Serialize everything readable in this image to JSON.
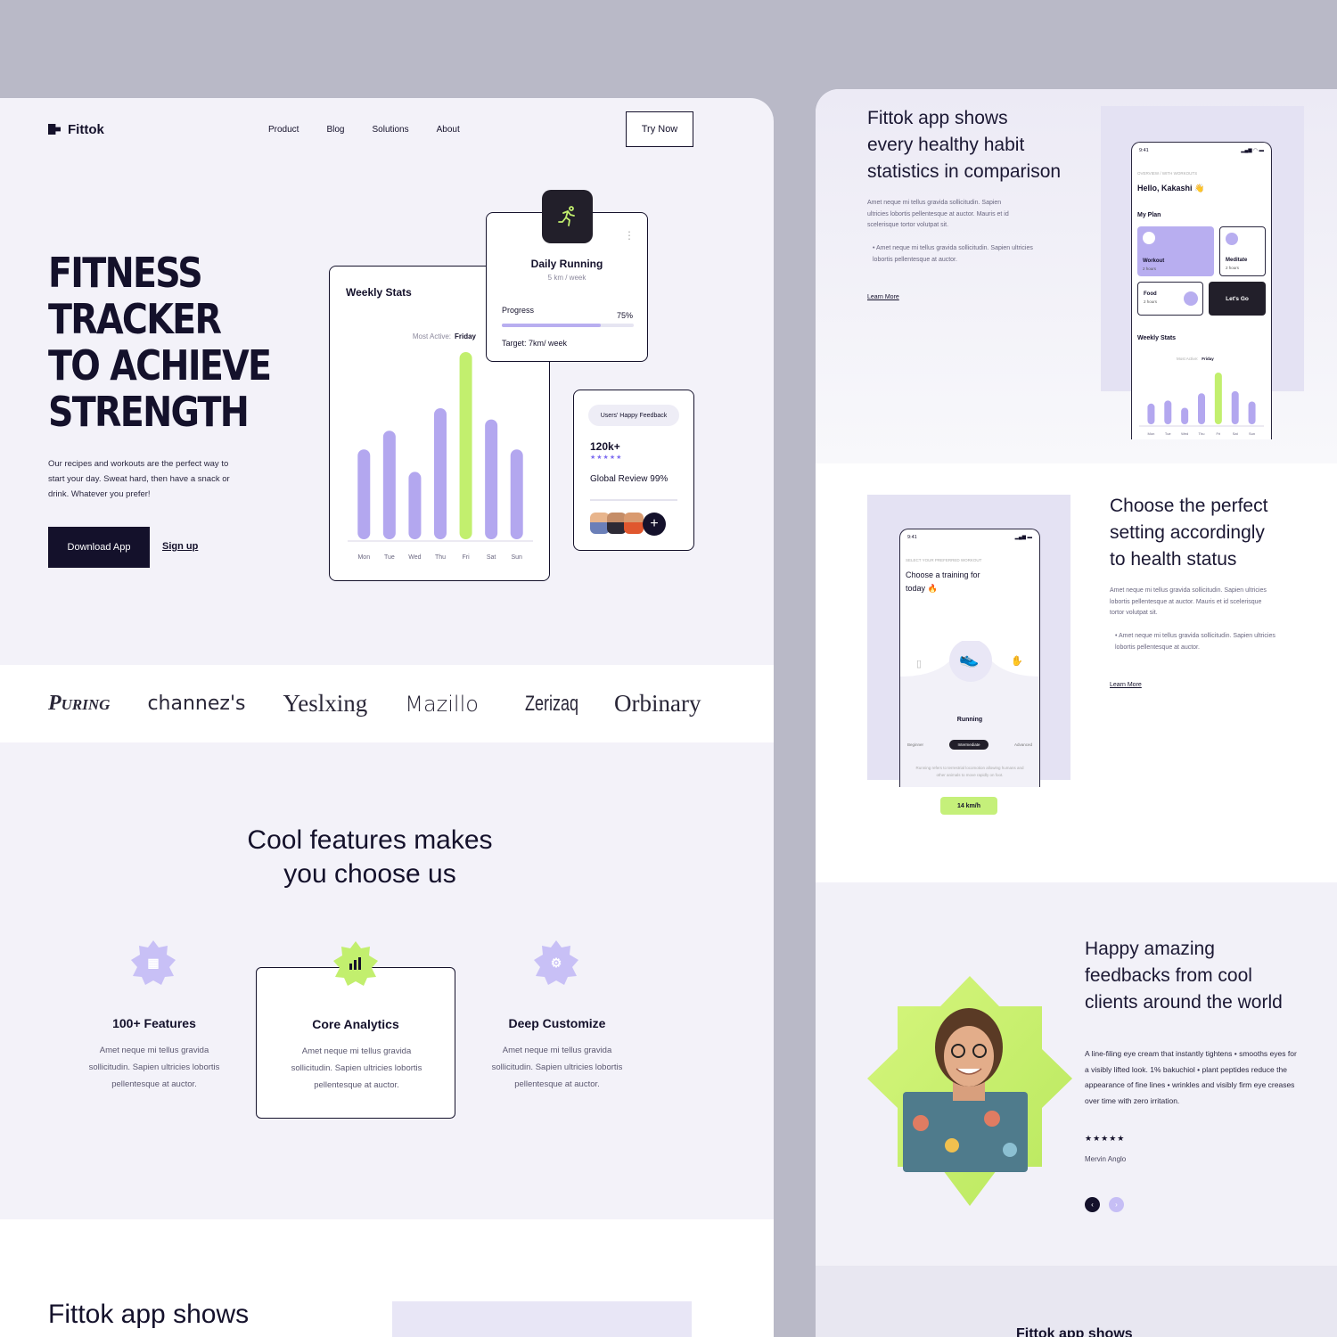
{
  "nav": {
    "logo": "Fittok",
    "links": [
      "Product",
      "Blog",
      "Solutions",
      "About"
    ],
    "cta": "Try Now"
  },
  "hero": {
    "title_lines": [
      "FITNESS",
      "TRACKER",
      "TO ACHIEVE",
      "STRENGTH"
    ],
    "description": "Our recipes and workouts are the perfect way to start your day. Sweat hard, then have a snack or drink. Whatever you prefer!",
    "primary_cta": "Download App",
    "secondary_cta": "Sign up"
  },
  "weekly_stats": {
    "title": "Weekly Stats",
    "most_active_label": "Most Active:",
    "most_active_value": "Friday"
  },
  "daily_running": {
    "title": "Daily Running",
    "subtitle": "5 km / week",
    "progress_label": "Progress",
    "progress_value": "75%",
    "progress": 0.75,
    "target": "Target: 7km/ week",
    "more": "⋮"
  },
  "feedback_card": {
    "pill": "Users' Happy Feedback",
    "count": "120k+",
    "stars": "★★★★★",
    "review": "Global Review 99%",
    "add": "+"
  },
  "brands": [
    "Puring",
    "channez's",
    "Yeslxing",
    "Mazillo",
    "Zerizaq",
    "Orbinary"
  ],
  "features": {
    "title_line1": "Cool features makes",
    "title_line2": "you choose us",
    "items": [
      {
        "title": "100+ Features",
        "desc": "Amet neque mi tellus gravida sollicitudin. Sapien ultricies lobortis pellentesque at auctor.",
        "icon": "grid-icon"
      },
      {
        "title": "Core Analytics",
        "desc": "Amet neque mi tellus gravida sollicitudin. Sapien ultricies lobortis pellentesque at auctor.",
        "icon": "bar-chart-icon"
      },
      {
        "title": "Deep Customize",
        "desc": "Amet neque mi tellus gravida sollicitudin. Sapien ultricies lobortis pellentesque at auctor.",
        "icon": "gear-icon"
      }
    ]
  },
  "bottom": {
    "title": "Fittok app shows"
  },
  "right": {
    "sec1": {
      "title_lines": [
        "Fittok app shows",
        "every healthy habit",
        "statistics in comparison"
      ],
      "p": "Amet neque mi tellus gravida sollicitudin. Sapien ultricies lobortis pellentesque at auctor. Mauris et id scelerisque tortor volutpat sit.",
      "bullet": "• Amet neque mi tellus gravida sollicitudin. Sapien ultricies lobortis pellentesque at auctor.",
      "link": "Learn More"
    },
    "phone1": {
      "time": "9:41",
      "status": "▂▄▆ ◠ ▬",
      "small": "OVERVIEW / WITH WORKOUTS",
      "hello": "Hello, Kakashi 👋",
      "plan": "My Plan",
      "tiles": [
        {
          "label": "Workout",
          "sub": "2 hours"
        },
        {
          "label": "Meditate",
          "sub": "2 hours"
        },
        {
          "label": "Food",
          "sub": "2 hours"
        }
      ],
      "go": "Let's Go",
      "weekly": "Weekly Stats",
      "most_label": "Most Active:",
      "most_value": "Friday"
    },
    "sec2": {
      "title_lines": [
        "Choose the perfect",
        "setting accordingly",
        "to health status"
      ],
      "p": "Amet neque mi tellus gravida sollicitudin. Sapien ultricies lobortis pellentesque at auctor. Mauris et id scelerisque tortor volutpat sit.",
      "bullet": "• Amet neque mi tellus gravida sollicitudin. Sapien ultricies lobortis pellentesque at auctor.",
      "link": "Learn More"
    },
    "phone2": {
      "time": "9:41",
      "status": "▂▄▆ ▬",
      "small": "SELECT YOUR PREFERRED WORKOUT",
      "title": "Choose a training for today 🔥",
      "running": "Running",
      "tabs": [
        "Beginner",
        "Intermediate",
        "Advanced"
      ],
      "note": "Running refers to terrestrial locomotion allowing humans and other animals to move rapidly on foot.",
      "speed": "14 km/h"
    },
    "sec3": {
      "title_lines": [
        "Happy amazing",
        "feedbacks from cool",
        "clients around the world"
      ],
      "quote": "A line-filing eye cream that instantly tightens • smooths eyes for a visibly lifted look. 1% bakuchiol • plant peptides reduce the appearance of fine lines • wrinkles and visibly firm eye creases over time with zero irritation.",
      "stars": "★★★★★",
      "name": "Mervin Anglo",
      "prev": "‹",
      "next": "›"
    },
    "sec4": {
      "title": "Fittok app shows"
    }
  },
  "chart_data": [
    {
      "type": "bar",
      "title": "Weekly Stats",
      "categories": [
        "Mon",
        "Tue",
        "Wed",
        "Thu",
        "Fri",
        "Sat",
        "Sun"
      ],
      "values": [
        48,
        58,
        36,
        70,
        100,
        64,
        48
      ],
      "highlight": "Fri",
      "colors": {
        "bar": "#b3a7ef",
        "highlight": "#c2ef6e"
      }
    },
    {
      "type": "bar",
      "title": "Weekly Stats",
      "categories": [
        "Mon",
        "Tue",
        "Wed",
        "Thu",
        "Fri",
        "Sat",
        "Sun"
      ],
      "values": [
        40,
        46,
        32,
        60,
        100,
        64,
        44
      ],
      "highlight": "Fri",
      "colors": {
        "bar": "#b3a7ef",
        "highlight": "#c2ef6e"
      }
    }
  ]
}
